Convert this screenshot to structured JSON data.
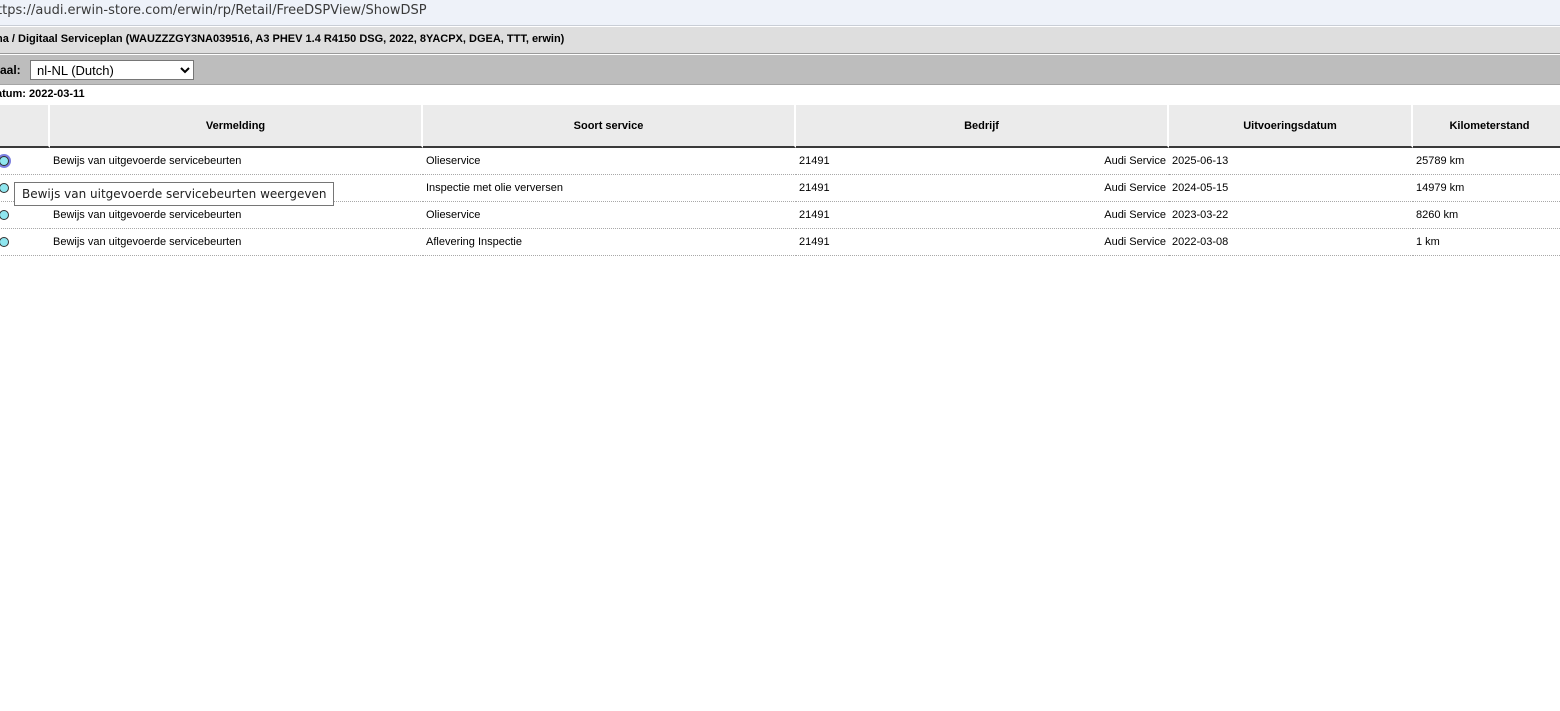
{
  "browser": {
    "url": "ttps://audi.erwin-store.com/erwin/rp/Retail/FreeDSPView/ShowDSP"
  },
  "header": {
    "breadcrumb": "na / Digitaal Serviceplan (WAUZZZGY3NA039516, A3 PHEV 1.4 R4150 DSG, 2022, 8YACPX, DGEA, TTT, erwin)"
  },
  "language": {
    "label": "taal:",
    "selected": "nl-NL (Dutch)"
  },
  "datum": "atum: 2022-03-11",
  "table": {
    "columns": [
      "",
      "Vermelding",
      "Soort service",
      "Bedrijf",
      "Uitvoeringsdatum",
      "Kilometerstand"
    ],
    "rows": [
      {
        "vermelding": "Bewijs van uitgevoerde servicebeurten",
        "soort": "Olieservice",
        "bedrijf_code": "21491",
        "bedrijf_naam": "Audi Service",
        "datum": "2025-06-13",
        "km": "25789 km"
      },
      {
        "vermelding": "",
        "soort": "Inspectie met olie verversen",
        "bedrijf_code": "21491",
        "bedrijf_naam": "Audi Service",
        "datum": "2024-05-15",
        "km": "14979 km"
      },
      {
        "vermelding": "Bewijs van uitgevoerde servicebeurten",
        "soort": "Olieservice",
        "bedrijf_code": "21491",
        "bedrijf_naam": "Audi Service",
        "datum": "2023-03-22",
        "km": "8260 km"
      },
      {
        "vermelding": "Bewijs van uitgevoerde servicebeurten",
        "soort": "Aflevering Inspectie",
        "bedrijf_code": "21491",
        "bedrijf_naam": "Audi Service",
        "datum": "2022-03-08",
        "km": "1 km"
      }
    ]
  },
  "tooltip": "Bewijs van uitgevoerde servicebeurten weergeven"
}
